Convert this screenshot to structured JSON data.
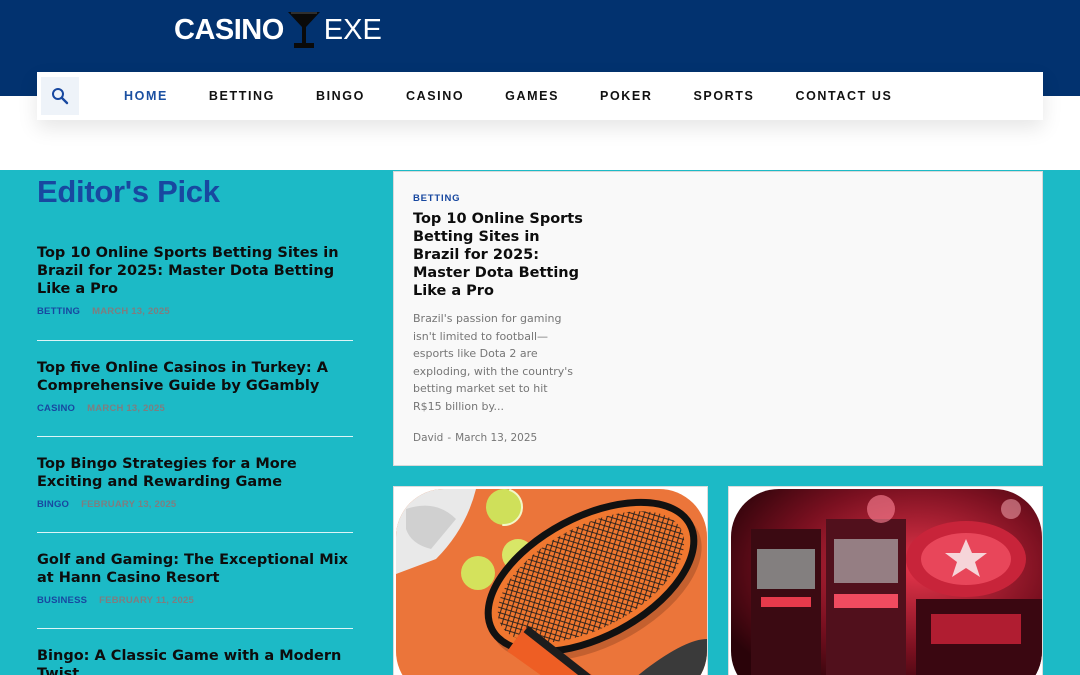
{
  "logo": {
    "word1": "CASINO",
    "word2": "EXE",
    "icon": "martini-glass-icon"
  },
  "nav": {
    "search_icon": "search-icon",
    "items": [
      "HOME",
      "BETTING",
      "BINGO",
      "CASINO",
      "GAMES",
      "POKER",
      "SPORTS",
      "CONTACT US"
    ],
    "active": "HOME"
  },
  "editors_pick": {
    "title": "Editor's Pick",
    "items": [
      {
        "title": "Top 10 Online Sports Betting Sites in Brazil for 2025: Master Dota Betting Like a Pro",
        "category": "BETTING",
        "date": "MARCH 13, 2025"
      },
      {
        "title": "Top five Online Casinos in Turkey: A Comprehensive Guide by GGambly",
        "category": "CASINO",
        "date": "MARCH 13, 2025"
      },
      {
        "title": "Top Bingo Strategies for a More Exciting and Rewarding Game",
        "category": "BINGO",
        "date": "FEBRUARY 13, 2025"
      },
      {
        "title": "Golf and Gaming: The Exceptional Mix at Hann Casino Resort",
        "category": "BUSINESS",
        "date": "FEBRUARY 11, 2025"
      },
      {
        "title": "Bingo: A Classic Game with a Modern Twist"
      }
    ]
  },
  "featured": {
    "category": "BETTING",
    "title": "Top 10 Online Sports Betting Sites in Brazil for 2025: Master Dota Betting Like a Pro",
    "excerpt": "Brazil's passion for gaming isn't limited to football—esports like Dota 2 are exploding, with the country's betting market set to hit R$15 billion by...",
    "author": "David",
    "separator": "-",
    "date": "March 13, 2025"
  },
  "image_cards": [
    {
      "image": "tennis-racket-and-balls-photo"
    },
    {
      "image": "slot-machines-photo"
    }
  ],
  "colors": {
    "header_bg": "#02326f",
    "accent_blue": "#1848a0",
    "teal_bg": "#1cbac6",
    "nav_active": "#1a4fa1"
  }
}
